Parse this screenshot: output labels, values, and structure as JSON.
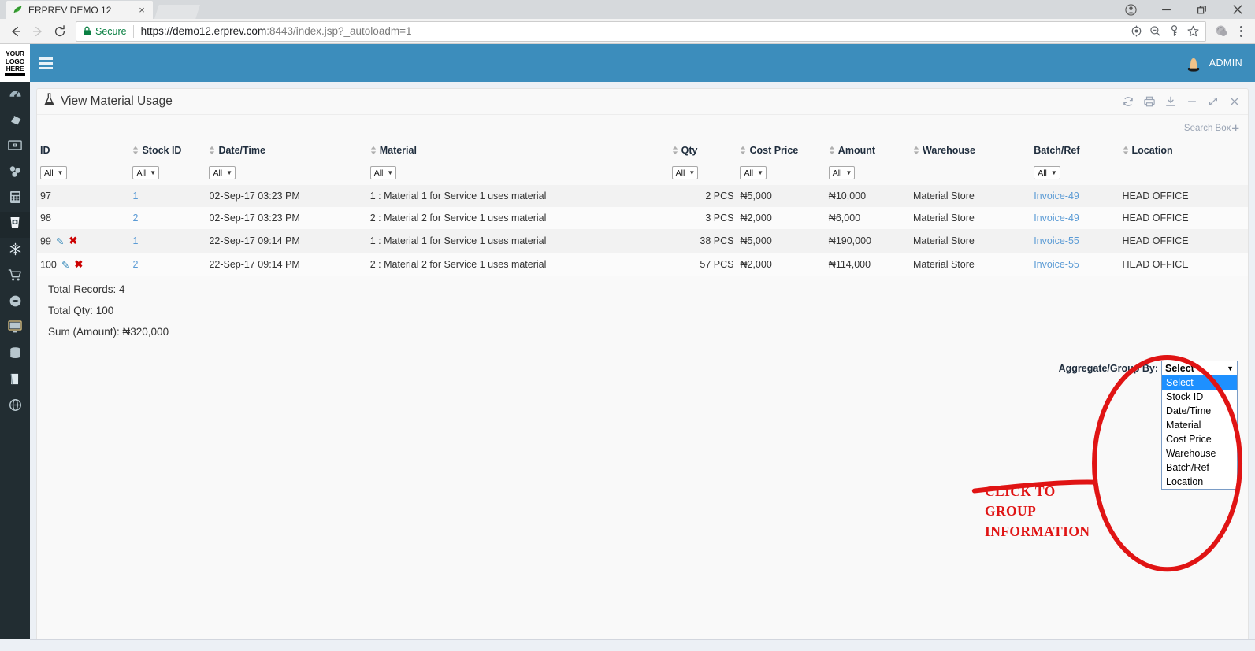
{
  "browser": {
    "tab": {
      "title": "ERPREV DEMO 12",
      "favicon": "leaf-icon",
      "close": "×"
    },
    "window_controls": {
      "profile": "profile-icon",
      "minimize": "—",
      "restore": "❐",
      "close": "✕"
    },
    "nav": {
      "back": "←",
      "forward": "→",
      "reload": "⟳"
    },
    "security_label": "Secure",
    "url_prefix": "https://demo12.erprev.com",
    "url_port": ":8443",
    "url_path": "/index.jsp?_autoloadm=1",
    "omnibox_icons": [
      "location-icon",
      "zoom-out-icon",
      "key-icon",
      "star-icon"
    ],
    "extension_icon": "extension-icon",
    "menu_icon": "chrome-menu-icon"
  },
  "app": {
    "logo": {
      "line1": "YOUR",
      "line2": "LOGO",
      "line3": "HERE"
    },
    "menu_toggle": "hamburger-icon",
    "user": {
      "name": "ADMIN",
      "avatar": "user-avatar-icon"
    },
    "sidebar_items": [
      {
        "icon": "dashboard-gauge-icon",
        "active": false
      },
      {
        "icon": "tag-icon",
        "active": false
      },
      {
        "icon": "money-bill-icon",
        "active": false
      },
      {
        "icon": "molecule-cubes-icon",
        "active": false
      },
      {
        "icon": "calculator-icon",
        "active": false
      },
      {
        "icon": "cup-icon",
        "active": true
      },
      {
        "icon": "snowflake-icon",
        "active": false
      },
      {
        "icon": "shopping-cart-icon",
        "active": false
      },
      {
        "icon": "disc-icon",
        "active": false
      },
      {
        "icon": "monitor-icon",
        "active": false
      },
      {
        "icon": "database-icon",
        "active": false
      },
      {
        "icon": "book-icon",
        "active": false
      },
      {
        "icon": "globe-icon",
        "active": false
      }
    ]
  },
  "panel": {
    "title": "View Material Usage",
    "title_icon": "flask-icon",
    "tools": [
      {
        "name": "refresh-icon",
        "glyph": "⟳"
      },
      {
        "name": "print-icon",
        "glyph": "⎙"
      },
      {
        "name": "download-icon",
        "glyph": "⤓"
      },
      {
        "name": "minimize-icon",
        "glyph": "−"
      },
      {
        "name": "expand-icon",
        "glyph": "⤢"
      },
      {
        "name": "close-icon",
        "glyph": "✕"
      }
    ],
    "search_box_label": "Search Box",
    "search_box_plus": "✚"
  },
  "table": {
    "filter_value": "All",
    "filter_caret": "▼",
    "columns": [
      {
        "label": "ID",
        "sortable": false,
        "filter": true,
        "align": "left"
      },
      {
        "label": "Stock ID",
        "sortable": true,
        "filter": true,
        "align": "left"
      },
      {
        "label": "Date/Time",
        "sortable": true,
        "filter": true,
        "align": "left"
      },
      {
        "label": "Material",
        "sortable": true,
        "filter": true,
        "align": "left"
      },
      {
        "label": "Qty",
        "sortable": true,
        "filter": true,
        "align": "right"
      },
      {
        "label": "Cost Price",
        "sortable": true,
        "filter": true,
        "align": "left"
      },
      {
        "label": "Amount",
        "sortable": true,
        "filter": true,
        "align": "left"
      },
      {
        "label": "Warehouse",
        "sortable": true,
        "filter": false,
        "align": "left"
      },
      {
        "label": "Batch/Ref",
        "sortable": false,
        "filter": true,
        "align": "left"
      },
      {
        "label": "Location",
        "sortable": true,
        "filter": false,
        "align": "left"
      }
    ],
    "rows": [
      {
        "id": "97",
        "editable": false,
        "stock_id": "1",
        "datetime": "02-Sep-17 03:23 PM",
        "material": "1 : Material 1 for Service 1 uses material",
        "qty": "2 PCS",
        "cost_price": "₦5,000",
        "amount": "₦10,000",
        "warehouse": "Material Store",
        "batch_ref": "Invoice-49",
        "location": "HEAD OFFICE"
      },
      {
        "id": "98",
        "editable": false,
        "stock_id": "2",
        "datetime": "02-Sep-17 03:23 PM",
        "material": "2 : Material 2 for Service 1 uses material",
        "qty": "3 PCS",
        "cost_price": "₦2,000",
        "amount": "₦6,000",
        "warehouse": "Material Store",
        "batch_ref": "Invoice-49",
        "location": "HEAD OFFICE"
      },
      {
        "id": "99",
        "editable": true,
        "stock_id": "1",
        "datetime": "22-Sep-17 09:14 PM",
        "material": "1 : Material 1 for Service 1 uses material",
        "qty": "38 PCS",
        "cost_price": "₦5,000",
        "amount": "₦190,000",
        "warehouse": "Material Store",
        "batch_ref": "Invoice-55",
        "location": "HEAD OFFICE"
      },
      {
        "id": "100",
        "editable": true,
        "stock_id": "2",
        "datetime": "22-Sep-17 09:14 PM",
        "material": "2 : Material 2 for Service 1 uses material",
        "qty": "57 PCS",
        "cost_price": "₦2,000",
        "amount": "₦114,000",
        "warehouse": "Material Store",
        "batch_ref": "Invoice-55",
        "location": "HEAD OFFICE"
      }
    ],
    "edit_icon": "✎",
    "delete_icon": "✖"
  },
  "totals": {
    "records": "Total Records: 4",
    "qty": "Total Qty: 100",
    "amount": "Sum (Amount): ₦320,000"
  },
  "group_by": {
    "label": "Aggregate/Group By:",
    "selected": "Select",
    "caret": "▼",
    "options": [
      "Select",
      "Stock ID",
      "Date/Time",
      "Material",
      "Cost Price",
      "Warehouse",
      "Batch/Ref",
      "Location"
    ]
  },
  "annotation": {
    "text_line1": "CLICK TO",
    "text_line2": "GROUP",
    "text_line3": "INFORMATION",
    "color": "#e01414"
  },
  "colors": {
    "topbar_blue": "#3c8dbc",
    "sidebar_dark": "#222d32",
    "link_blue": "#5b9bd5",
    "annotation_red": "#e01414",
    "secure_green": "#0b8043",
    "select_highlight": "#1e90ff"
  }
}
